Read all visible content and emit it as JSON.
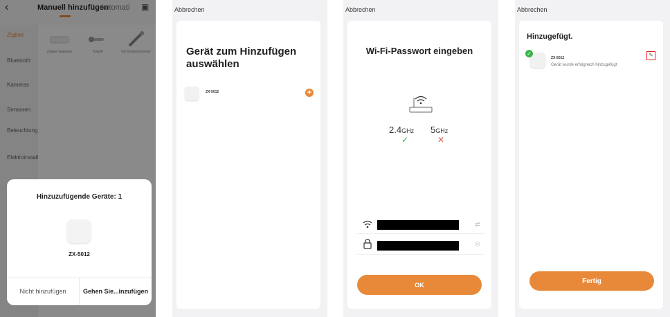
{
  "screen1": {
    "back_icon": "chevron-left-icon",
    "tab_manual": "Manuell hinzufügen",
    "tab_auto": "Automati",
    "scan_icon": "scan-icon",
    "categories": [
      "Zigbee",
      "Bluetooth",
      "Kameras",
      "Sensoren",
      "Beleuchtung",
      "Elektroinstallationen"
    ],
    "products": [
      "Zigbee Gateway",
      "Torgriff",
      "Tür-Schließzylinder"
    ],
    "sheet": {
      "title": "Hinzuzufügende Geräte: 1",
      "device_model": "ZX-5012",
      "skip_label": "Nicht hinzufügen",
      "go_label": "Gehen Sie...inzufügen"
    }
  },
  "screen2": {
    "cancel_label": "Abbrechen",
    "title": "Gerät zum Hinzufügen auswählen",
    "device_model": "ZX-5012",
    "add_label": "+"
  },
  "screen3": {
    "cancel_label": "Abbrechen",
    "title": "Wi-Fi-Passwort eingeben",
    "band_24": "2.4",
    "band_5": "5",
    "band_unit": "GHz",
    "ok_label": "OK"
  },
  "screen4": {
    "cancel_label": "Abbrechen",
    "title": "Hinzugefügt.",
    "device_model": "ZX-5012",
    "status": "Gerät wurde erfolgreich hinzugefügt",
    "done_label": "Fertig"
  },
  "colors": {
    "accent": "#e8893a",
    "success": "#3bb54a",
    "error": "#e0554a",
    "highlight_box": "#e02020"
  }
}
